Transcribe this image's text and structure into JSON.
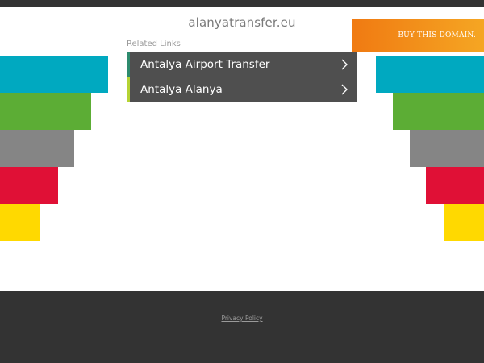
{
  "header": {
    "domain": "alanyatransfer.eu",
    "buy_label": "BUY THIS DOMAIN."
  },
  "related": {
    "heading": "Related Links",
    "links": [
      {
        "label": "Antalya Airport Transfer",
        "accent": "#2e8b6e"
      },
      {
        "label": "Antalya Alanya",
        "accent": "#b5d334"
      }
    ]
  },
  "decoration": {
    "colors": [
      "#00a9c0",
      "#5cad35",
      "#858585",
      "#e01036",
      "#ffd900"
    ],
    "icons": [
      "chevron-right-icon"
    ]
  },
  "footer": {
    "privacy_label": "Privacy Policy"
  },
  "theme": {
    "dark": "#333333",
    "link_bg": "#4f4f4f",
    "banner_start": "#f07a12",
    "banner_end": "#f5a623"
  }
}
